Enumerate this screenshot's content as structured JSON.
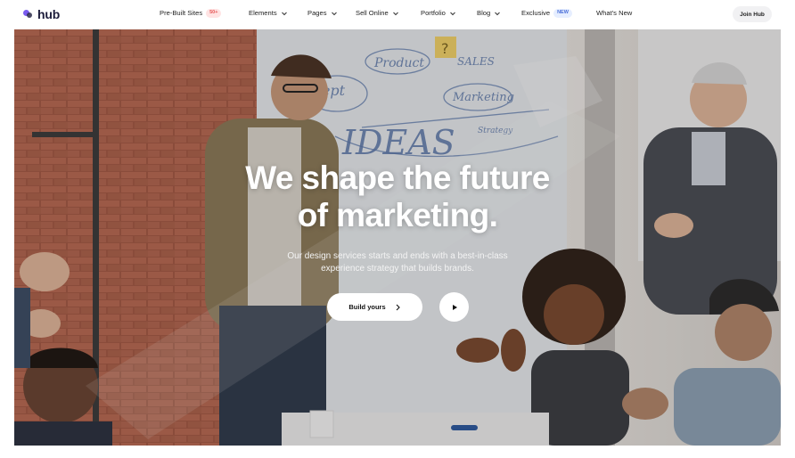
{
  "brand": {
    "name": "hub"
  },
  "nav": {
    "items": [
      {
        "label": "Pre-Built Sites",
        "badge": "50+"
      },
      {
        "label": "Elements"
      },
      {
        "label": "Pages"
      },
      {
        "label": "Sell Online"
      },
      {
        "label": "Portfolio"
      },
      {
        "label": "Blog"
      },
      {
        "label": "Exclusive",
        "badge": "NEW"
      },
      {
        "label": "What's New"
      }
    ],
    "join_label": "Join Hub"
  },
  "hero": {
    "headline_line1": "We shape the future",
    "headline_line2": "of marketing.",
    "subtitle_line1": "Our design services starts and ends with a best-in-class",
    "subtitle_line2": "experience strategy that builds brands.",
    "cta_label": "Build yours",
    "whiteboard_words": [
      "IDEAS",
      "Product",
      "SALES",
      "Marketing",
      "cept",
      "Strategy",
      "?"
    ]
  },
  "icons": {
    "chevron": "chevron-down-icon",
    "arrow": "chevron-right-icon",
    "play": "play-icon"
  },
  "colors": {
    "brand_purple": "#7a5cf0",
    "badge_red": "#e55656",
    "badge_blue": "#4a6fd8"
  }
}
